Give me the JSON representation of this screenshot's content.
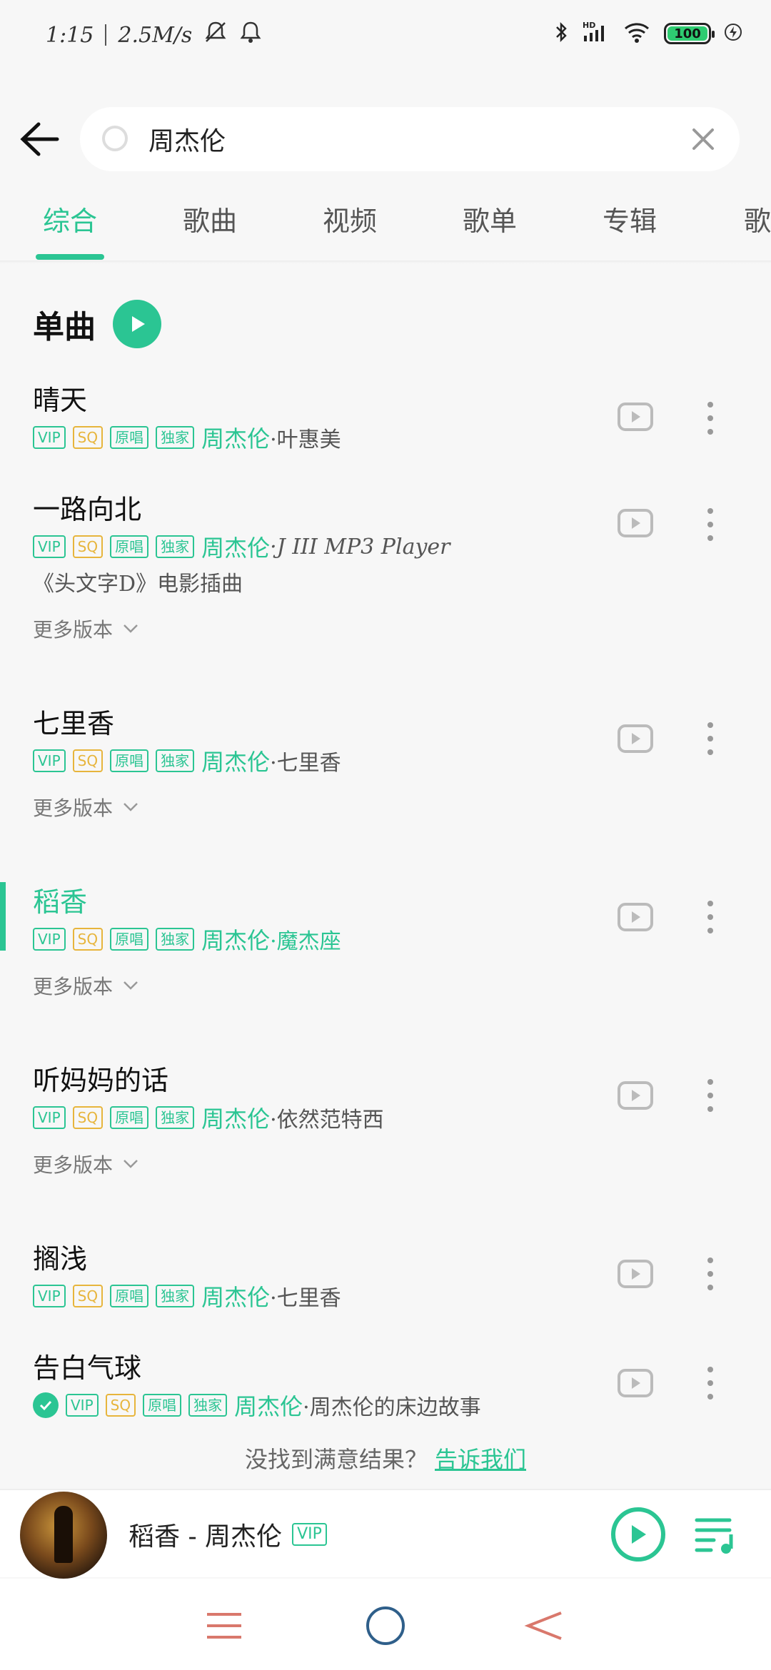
{
  "status": {
    "time": "1:15",
    "speed": "2.5M/s",
    "battery": "100",
    "signal_label": "HD"
  },
  "search": {
    "query": "周杰伦",
    "placeholder": ""
  },
  "tabs": [
    {
      "label": "综合",
      "active": true
    },
    {
      "label": "歌曲",
      "active": false
    },
    {
      "label": "视频",
      "active": false
    },
    {
      "label": "歌单",
      "active": false
    },
    {
      "label": "专辑",
      "active": false
    },
    {
      "label": "歌",
      "active": false
    }
  ],
  "section": {
    "title": "单曲"
  },
  "songs": [
    {
      "title": "晴天",
      "artist": "周杰伦",
      "sub": "·叶惠美",
      "desc": "",
      "more": ""
    },
    {
      "title": "一路向北",
      "artist": "周杰伦",
      "sub": "·J III MP3 Player",
      "desc": "《头文字D》电影插曲",
      "more": "更多版本"
    },
    {
      "title": "七里香",
      "artist": "周杰伦",
      "sub": "·七里香",
      "desc": "",
      "more": "更多版本"
    },
    {
      "title": "稻香",
      "artist": "周杰伦",
      "sub": "·魔杰座",
      "desc": "",
      "more": "更多版本"
    },
    {
      "title": "听妈妈的话",
      "artist": "周杰伦",
      "sub": "·依然范特西",
      "desc": "",
      "more": "更多版本"
    },
    {
      "title": "搁浅",
      "artist": "周杰伦",
      "sub": "·七里香",
      "desc": "",
      "more": ""
    },
    {
      "title": "告白气球",
      "artist": "周杰伦",
      "sub": "·周杰伦的床边故事",
      "desc": "",
      "more": ""
    }
  ],
  "tags": {
    "vip": "VIP",
    "sq": "SQ",
    "original": "原唱",
    "exclusive": "独家"
  },
  "feedback": {
    "text": "没找到满意结果？",
    "link": "告诉我们"
  },
  "player": {
    "now_playing": "稻香 - 周杰伦",
    "badge": "VIP"
  },
  "colors": {
    "accent": "#2bc593",
    "sq": "#e7b53c"
  }
}
